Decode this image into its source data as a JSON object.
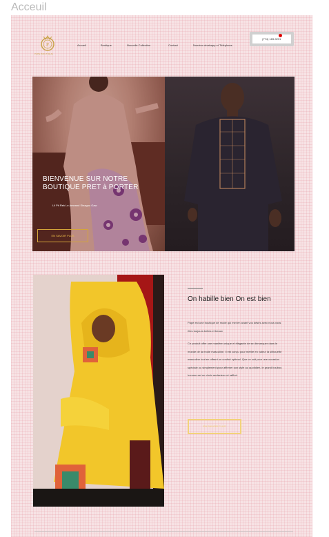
{
  "frame": {
    "label": "Acceuil"
  },
  "header": {
    "logo_text": "PAPE BOUTIQUE",
    "nav": [
      "Accueil",
      "Boutique",
      "Nouvelle Collection",
      "Contact",
      "Numéro whatsapp et Téléphone"
    ],
    "phone_label": "(774) 183-9231"
  },
  "hero": {
    "title": "BIENVENUE SUR NOTRE BOUTIQUE PRET à PORTER",
    "subtitle": "Lil Pit Rek Le Amnand Sinagou Gaw",
    "button_label": "EN SAVOIR PLUS"
  },
  "about": {
    "title": "On habille bien On est bien",
    "paragraph1": "Pape est une boutique de mode qui met en avant vos désirs avec nous vous êtes toujours belles et beaux",
    "paragraph2": "Ce produit offre une manière unique et élégante de se démarquer dans le monde de la mode masculine. Il est conçu pour mettre en valeur la silhouette masculine tout en offrant un confort optimal. Que ce soit pour une occasion spéciale ou simplement pour affirmer son style au quotidien, le grand boubou homme est un choix audacieux et raffiné.",
    "button_label": "EN SAVOIR PLUS"
  },
  "colors": {
    "canvas": "#f7e3e5",
    "gold": "#d4a53a",
    "phone_dot": "#e00000"
  }
}
